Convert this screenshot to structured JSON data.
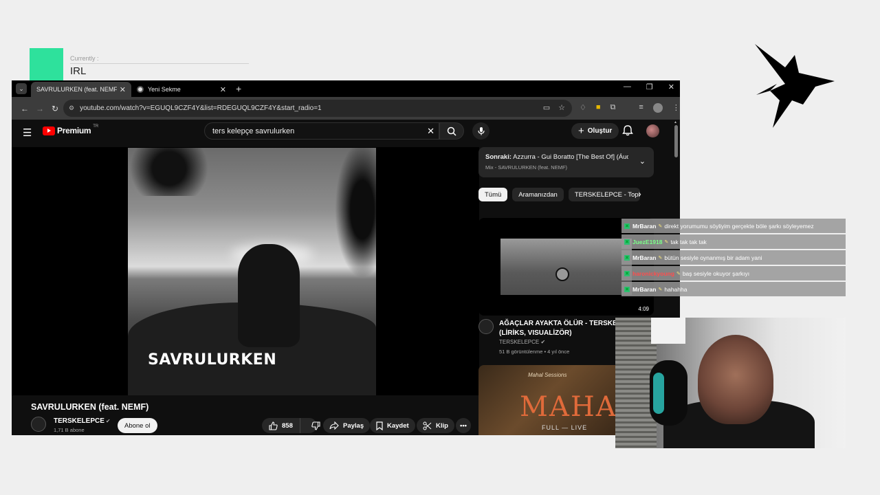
{
  "overlay": {
    "status_kicker": "Currently :",
    "status_value": "IRL",
    "accent_color": "#2ee19c"
  },
  "browser": {
    "tabs": [
      {
        "title": "SAVRULURKEN (feat. NEMF) - Y",
        "icon": "youtube-icon",
        "active": true
      },
      {
        "title": "Yeni Sekme",
        "icon": "chrome-icon",
        "active": false
      }
    ],
    "url": "youtube.com/watch?v=EGUQL9CZF4Y&list=RDEGUQL9CZF4Y&start_radio=1"
  },
  "youtube": {
    "logo_text": "Premium",
    "logo_region": "TR",
    "search_query": "ters kelepçe savrulurken",
    "create_label": "Oluştur",
    "artwork_title": "SAVRULURKEN",
    "video_title": "SAVRULURKEN (feat. NEMF)",
    "channel_name": "TERSKELEPCE",
    "channel_subs": "1,71 B abone",
    "subscribe_label": "Abone ol",
    "like_count": "858",
    "share_label": "Paylaş",
    "save_label": "Kaydet",
    "clip_label": "Klip",
    "up_next": {
      "prefix": "Sonraki:",
      "title": "Azzurra - Gui Boratto [The Best Of] (Áudio...",
      "mix": "Mix - SAVRULURKEN (feat. NEMF)"
    },
    "chips": [
      "Tümü",
      "Aramanızdan",
      "TERSKELEPCE - Topic ö"
    ],
    "recommendations": [
      {
        "title": "AĞAÇLAR AYAKTA ÖLÜR - TERSKELEPCE (LİRİKS, VISUALİZÖR)",
        "channel": "TERSKELEPCE",
        "meta": "51 B görüntülenme • 4 yıl önce",
        "duration": "4:09"
      },
      {
        "thumb_text": "MAHAL",
        "thumb_subtext": "FULL — LIVE",
        "thumb_script": "Mahal Sessions"
      }
    ]
  },
  "chat": [
    {
      "user": "MrBaran",
      "user_color": "#ffffff",
      "message": "direkt yorumumu söyliyim gerçekte böle şarkı söyleyemez"
    },
    {
      "user": "JuezE1918",
      "user_color": "#7dff8a",
      "message": "tak tak tak tak"
    },
    {
      "user": "MrBaran",
      "user_color": "#ffffff",
      "message": "bütün sesiyle oynanmış bir adam yani"
    },
    {
      "user": "haronickyoung",
      "user_color": "#ff4d4d",
      "message": "baş sesiyle okuyor şarkıyı"
    },
    {
      "user": "MrBaran",
      "user_color": "#ffffff",
      "message": "hahahha"
    }
  ]
}
